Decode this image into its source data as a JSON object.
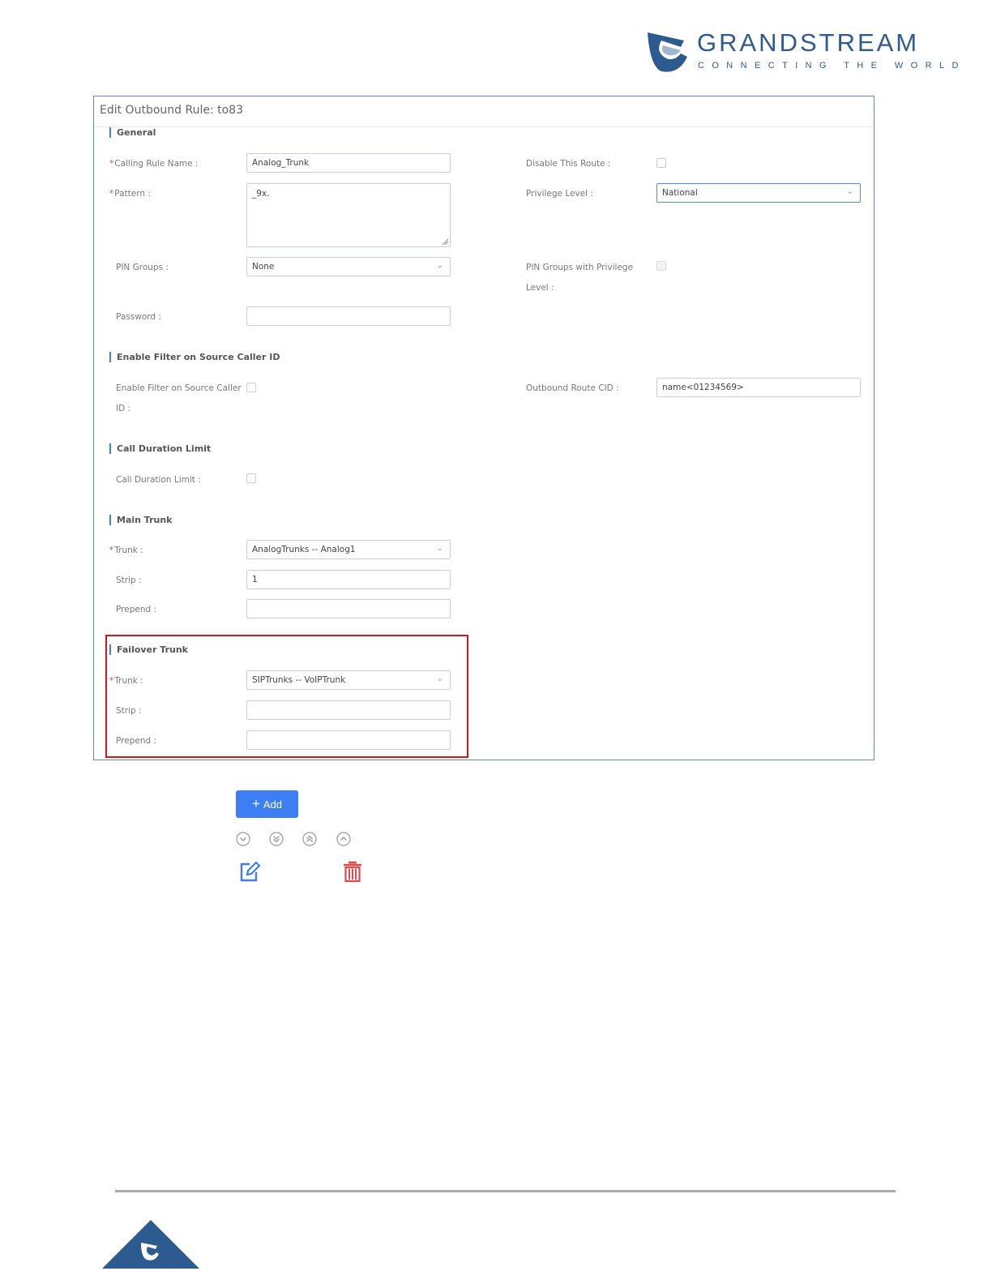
{
  "brand": {
    "name": "GRANDSTREAM",
    "tagline": "CONNECTING THE WORLD",
    "colors": {
      "primary": "#2e5b8f",
      "accent": "#3d7ef5",
      "highlight": "#d9141c",
      "delete": "#e64848"
    }
  },
  "dialog": {
    "title": "Edit Outbound Rule: to83",
    "sections": {
      "general": "General",
      "filter": "Enable Filter on Source Caller ID",
      "duration": "Call Duration Limit",
      "main_trunk": "Main Trunk",
      "failover_trunk": "Failover Trunk"
    },
    "general": {
      "calling_rule_name_label": "Calling Rule Name :",
      "calling_rule_name_value": "Analog_Trunk",
      "pattern_label": "Pattern :",
      "pattern_value": "_9x.",
      "pin_groups_label": "PIN Groups :",
      "pin_groups_value": "None",
      "password_label": "Password :",
      "password_value": "",
      "disable_route_label": "Disable This Route :",
      "privilege_level_label": "Privilege Level :",
      "privilege_level_value": "National",
      "pin_groups_privilege_label_1": "PIN Groups with Privilege",
      "pin_groups_privilege_label_2": "Level :"
    },
    "filter": {
      "enable_label_1": "Enable Filter on Source Caller",
      "enable_label_2": "ID :",
      "outbound_cid_label": "Outbound Route CID :",
      "outbound_cid_value": "name<01234569>"
    },
    "duration": {
      "limit_label": "Call Duration Limit :"
    },
    "main_trunk": {
      "trunk_label": "Trunk :",
      "trunk_value": "AnalogTrunks -- Analog1",
      "strip_label": "Strip :",
      "strip_value": "1",
      "prepend_label": "Prepend :",
      "prepend_value": ""
    },
    "failover_trunk": {
      "trunk_label": "Trunk :",
      "trunk_value": "SIPTrunks -- VoIPTrunk",
      "strip_label": "Strip :",
      "strip_value": "",
      "prepend_label": "Prepend :",
      "prepend_value": ""
    }
  },
  "actions": {
    "add_label": "Add",
    "add_icon": "plus-icon",
    "icons": [
      "move-down-icon",
      "move-bottom-icon",
      "move-top-icon",
      "move-up-icon",
      "edit-icon",
      "delete-icon"
    ]
  }
}
